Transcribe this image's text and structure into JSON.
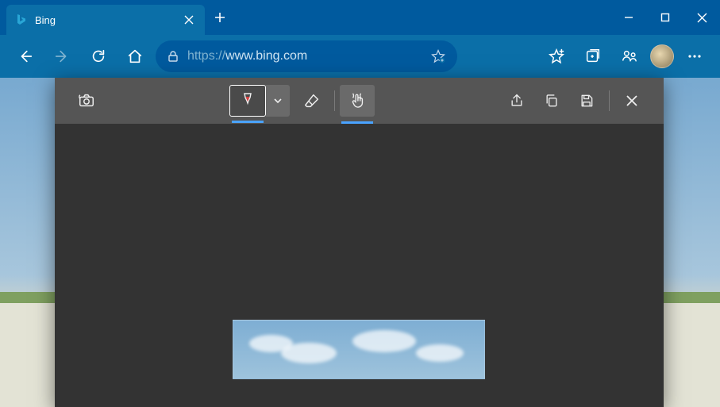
{
  "window": {
    "tab_title": "Bing",
    "url_scheme": "https://",
    "url_host": "www.bing.com"
  },
  "capture_toolbar": {
    "pen_color": "#d94040"
  }
}
